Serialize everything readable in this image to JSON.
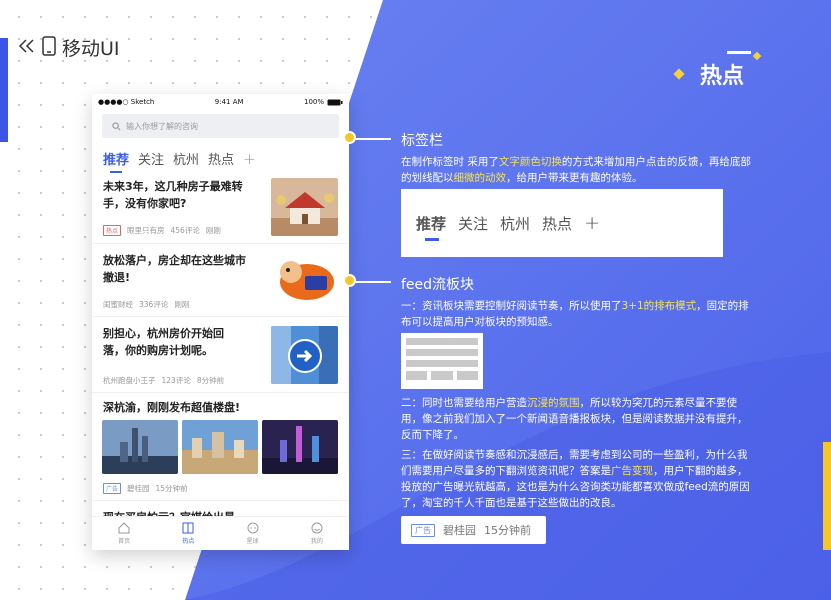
{
  "brand": {
    "back_icon": "double-chevron-left-icon",
    "device_icon": "phone-icon",
    "title": "移动UI"
  },
  "header": {
    "title": "热点"
  },
  "phone": {
    "status": {
      "carrier": "●●●●○ Sketch",
      "wifi_icon": "wifi-icon",
      "time": "9:41 AM",
      "battery": "100%"
    },
    "search": {
      "icon": "search-icon",
      "placeholder": "输入你想了解的咨询"
    },
    "tabs": [
      {
        "label": "推荐",
        "active": true
      },
      {
        "label": "关注",
        "active": false
      },
      {
        "label": "杭州",
        "active": false
      },
      {
        "label": "热点",
        "active": false
      },
      {
        "label": "+",
        "active": false
      }
    ],
    "feed": [
      {
        "title": "未来3年，这几种房子最难转手，没有你家吧?",
        "tag": "热点",
        "source": "眼里只有房",
        "comments": "456评论",
        "time": "刚刚"
      },
      {
        "title": "放松落户，房企却在这些城市撤退!",
        "source": "闺蜜财经",
        "comments": "336评论",
        "time": "刚刚"
      },
      {
        "title": "别担心，杭州房价开始回落，你的购房计划呢。",
        "source": "杭州跑盘小王子",
        "comments": "123评论",
        "time": "8分钟前"
      },
      {
        "title": "深杭渝，刚刚发布超值楼盘!",
        "tag": "广告",
        "source": "碧桂园",
        "time": "15分钟前"
      },
      {
        "title": "现在买房怕亏？官媒给出最"
      }
    ],
    "tabbar": [
      {
        "label": "首页",
        "icon": "home-icon",
        "active": false
      },
      {
        "label": "热点",
        "icon": "book-icon",
        "active": true
      },
      {
        "label": "星球",
        "icon": "chat-icon",
        "active": false
      },
      {
        "label": "我的",
        "icon": "smile-icon",
        "active": false
      }
    ]
  },
  "sections": {
    "tabs": {
      "title": "标签栏",
      "p1": "在制作标签时 采用了",
      "h1": "文字颜色切换",
      "p2": "的方式来增加用户点击的反馈，再给底部的划线配以",
      "h2": "细微的动效",
      "p3": "，给用户带来更有趣的体验。"
    },
    "feed": {
      "title": "feed流板块",
      "para1": {
        "a": "一：资讯板块需要控制好阅读节奏，所以使用了",
        "h": "3+1的排布模式",
        "b": "，固定的排布可以提高用户对板块的预知感。"
      },
      "para2": {
        "a": "二：同时也需要给用户营造",
        "h": "沉浸的氛围",
        "b": "，所以较为突兀的元素尽量不要使用，像之前我们加入了一个新闻语音播报板块，但是阅读数据并没有提升，反而下降了。"
      },
      "para3": {
        "a": "三：在做好阅读节奏感和沉浸感后，需要考虑到公司的一些盈利，为什么我们需要用户尽量多的下翻浏览资讯呢？答案是",
        "h": "广告变现",
        "b": "，用户下翻的越多，投放的广告曝光就越高，这也是为什么咨询类功能都喜欢做成feed流的原因了，淘宝的千人千面也是基于这些做出的改良。"
      }
    },
    "meta_demo": {
      "tag": "广告",
      "source": "碧桂园",
      "time": "15分钟前"
    }
  },
  "colors": {
    "primary": "#3d5de6",
    "accent": "#f5c629",
    "highlight": "#f8e54b",
    "bg_blue": "#5b74ee"
  }
}
